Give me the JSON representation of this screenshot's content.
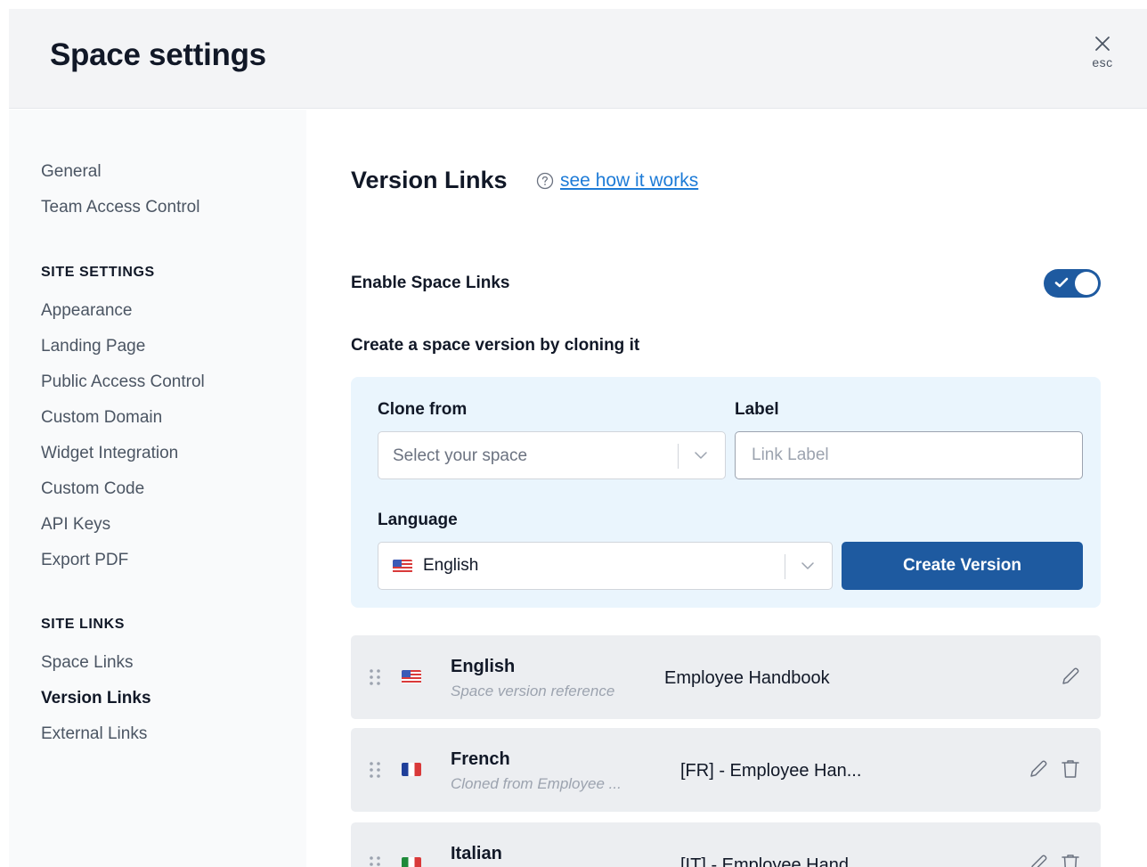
{
  "header": {
    "title": "Space settings",
    "close_label": "esc"
  },
  "sidebar": {
    "top_items": [
      {
        "label": "General"
      },
      {
        "label": "Team Access Control"
      }
    ],
    "site_settings": {
      "heading": "SITE SETTINGS",
      "items": [
        {
          "label": "Appearance"
        },
        {
          "label": "Landing Page"
        },
        {
          "label": "Public Access Control"
        },
        {
          "label": "Custom Domain"
        },
        {
          "label": "Widget Integration"
        },
        {
          "label": "Custom Code"
        },
        {
          "label": "API Keys"
        },
        {
          "label": "Export PDF"
        }
      ]
    },
    "site_links": {
      "heading": "SITE LINKS",
      "items": [
        {
          "label": "Space Links"
        },
        {
          "label": "Version Links",
          "active": true
        },
        {
          "label": "External Links"
        }
      ]
    }
  },
  "main": {
    "title": "Version Links",
    "help_link": "see how it works",
    "enable_label": "Enable Space Links",
    "enabled": true,
    "create_label": "Create a space version by cloning it",
    "form": {
      "clone_from_label": "Clone from",
      "clone_from_placeholder": "Select your space",
      "label_label": "Label",
      "label_placeholder": "Link Label",
      "language_label": "Language",
      "language_value": "English",
      "create_button": "Create Version"
    },
    "versions": [
      {
        "language": "English",
        "subtitle": "Space version reference",
        "label": "Employee Handbook",
        "flag": "us-flag-icon",
        "deletable": false
      },
      {
        "language": "French",
        "subtitle": "Cloned from Employee ...",
        "label": "[FR] - Employee Han...",
        "flag": "fr-flag-icon",
        "deletable": true
      },
      {
        "language": "Italian",
        "subtitle": "",
        "label": "[IT] - Employee Hand...",
        "flag": "it-flag-icon",
        "deletable": true
      }
    ]
  },
  "colors": {
    "accent": "#1e5aa0",
    "link": "#1d7bd7",
    "panel": "#eaf5fd",
    "row": "#eceef1"
  }
}
